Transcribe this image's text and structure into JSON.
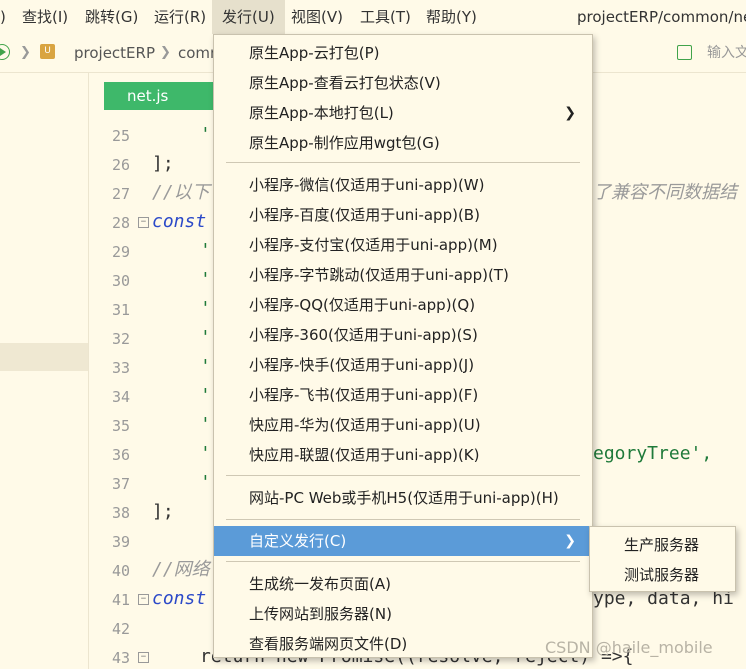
{
  "menubar": {
    "items": [
      {
        "label": "查找(I)"
      },
      {
        "label": "跳转(G)"
      },
      {
        "label": "运行(R)"
      },
      {
        "label": "发行(U)"
      },
      {
        "label": "视图(V)"
      },
      {
        "label": "工具(T)"
      },
      {
        "label": "帮助(Y)"
      }
    ],
    "partial_label": ")",
    "active_item": "发行(U)",
    "path_title": "projectERP/common/ne"
  },
  "toolbar": {
    "breadcrumb": [
      "projectERP",
      "comm"
    ],
    "search_placeholder": "输入文"
  },
  "editor": {
    "file_tab": "net.js",
    "line_numbers": [
      "25",
      "26",
      "27",
      "28",
      "29",
      "30",
      "31",
      "32",
      "33",
      "34",
      "35",
      "36",
      "37",
      "38",
      "39",
      "40",
      "41",
      "42",
      "43"
    ],
    "fold_markers": [
      "28",
      "41",
      "43"
    ],
    "code": {
      "l25": "'(",
      "l26": "];",
      "l27_comment": "//以下",
      "l27_comment_tail": "了兼容不同数据结",
      "l28_kw": "const",
      "l29": "'",
      "l30": "'",
      "l31": "'",
      "l32": "'",
      "l33": "'",
      "l34": "'",
      "l35": "'",
      "l36": "'",
      "l36_tail": "egoryTree',",
      "l37": "'(",
      "l38": "];",
      "l40_comment": "//网络",
      "l41_kw": "const",
      "l41_tail": "ype, data, hi",
      "l43_head": "return new Promise((resolve, reject) =>{",
      "l43_tail": "ject) =>{"
    }
  },
  "dropdown": {
    "items": [
      {
        "label": "原生App-云打包(P)"
      },
      {
        "label": "原生App-查看云打包状态(V)"
      },
      {
        "label": "原生App-本地打包(L)",
        "has_submenu": true
      },
      {
        "label": "原生App-制作应用wgt包(G)"
      },
      {
        "label": "小程序-微信(仅适用于uni-app)(W)"
      },
      {
        "label": "小程序-百度(仅适用于uni-app)(B)"
      },
      {
        "label": "小程序-支付宝(仅适用于uni-app)(M)"
      },
      {
        "label": "小程序-字节跳动(仅适用于uni-app)(T)"
      },
      {
        "label": "小程序-QQ(仅适用于uni-app)(Q)"
      },
      {
        "label": "小程序-360(仅适用于uni-app)(S)"
      },
      {
        "label": "小程序-快手(仅适用于uni-app)(J)"
      },
      {
        "label": "小程序-飞书(仅适用于uni-app)(F)"
      },
      {
        "label": "快应用-华为(仅适用于uni-app)(U)"
      },
      {
        "label": "快应用-联盟(仅适用于uni-app)(K)"
      },
      {
        "label": "网站-PC Web或手机H5(仅适用于uni-app)(H)"
      },
      {
        "label": "自定义发行(C)",
        "has_submenu": true,
        "active": true
      },
      {
        "label": "生成统一发布页面(A)"
      },
      {
        "label": "上传网站到服务器(N)"
      },
      {
        "label": "查看服务端网页文件(D)"
      }
    ],
    "arrow": "❯"
  },
  "submenu": {
    "items": [
      {
        "label": "生产服务器"
      },
      {
        "label": "测试服务器"
      }
    ]
  },
  "watermark": "CSDN @haile_mobile",
  "colors": {
    "background": "#fffae8",
    "file_tab": "#3eb86a",
    "menu_highlight": "#5b9bd8",
    "keyword": "#2b49c8",
    "comment": "#9a9a9a"
  }
}
